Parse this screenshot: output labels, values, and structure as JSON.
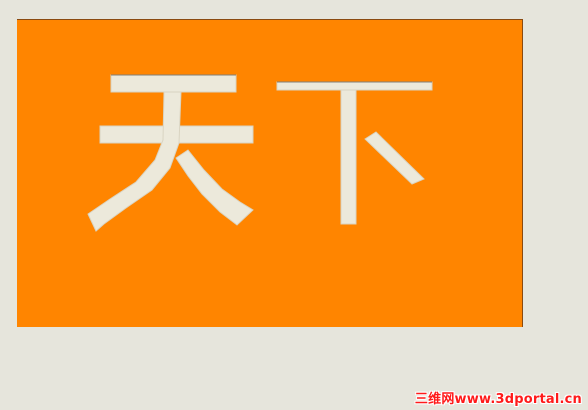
{
  "canvas": {
    "background_color": "#e6e5dc",
    "panel_color": "#ff8500",
    "glyph_color": "#ece9db"
  },
  "artwork": {
    "characters": [
      "天",
      "下"
    ]
  },
  "watermark": {
    "text": "三维网www.3dportal.cn",
    "color": "#ff1a1a"
  }
}
